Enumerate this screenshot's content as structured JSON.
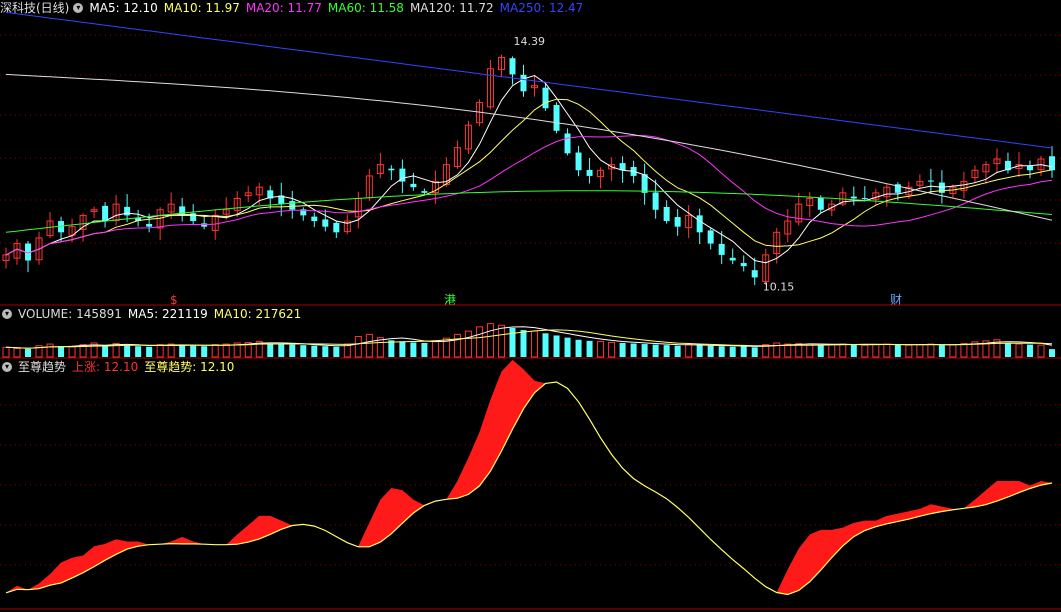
{
  "main": {
    "title": "深科技(日线)",
    "ma_legend": [
      {
        "label": "MA5: 12.10",
        "color": "#ffffff"
      },
      {
        "label": "MA10: 11.97",
        "color": "#ffff66"
      },
      {
        "label": "MA20: 11.77",
        "color": "#ff33ff"
      },
      {
        "label": "MA60: 11.58",
        "color": "#33ff33"
      },
      {
        "label": "MA120: 11.72",
        "color": "#dddddd"
      },
      {
        "label": "MA250: 12.47",
        "color": "#3344ff"
      }
    ],
    "high_label": "14.39",
    "low_label": "10.15",
    "markers": [
      {
        "text": "$",
        "color": "#ff3333"
      },
      {
        "text": "港",
        "color": "#33ff33"
      },
      {
        "text": "财",
        "color": "#66aaff"
      }
    ]
  },
  "volume": {
    "title": "VOLUME: 145891",
    "legend": [
      {
        "label": "MA5: 221119",
        "color": "#ffffff"
      },
      {
        "label": "MA10: 217621",
        "color": "#ffff66"
      }
    ]
  },
  "indicator": {
    "title": "至尊趋势",
    "legend": [
      {
        "label": "上涨: 12.10",
        "color": "#ff3333"
      },
      {
        "label": "至尊趋势: 12.10",
        "color": "#ffff66"
      }
    ]
  },
  "colors": {
    "up": "#ff3333",
    "down": "#54ffff",
    "background": "#000000",
    "grid": "#8b0000",
    "separator": "#aa0000"
  },
  "chart_data": {
    "type": "candlestick",
    "price_range": [
      9.8,
      14.8
    ],
    "high": 14.39,
    "low": 10.15,
    "ma5_last": 12.1,
    "ma10_last": 11.97,
    "ma20_last": 11.77,
    "ma60_last": 11.58,
    "ma120_last": 11.72,
    "ma250_last": 12.47,
    "volume_last": 145891,
    "volume_ma5_last": 221119,
    "volume_ma10_last": 217621,
    "trend_last": 12.1,
    "close_series": [
      10.6,
      10.8,
      10.5,
      10.9,
      11.2,
      11.0,
      11.1,
      11.3,
      11.4,
      11.2,
      11.5,
      11.3,
      11.2,
      11.1,
      11.4,
      11.5,
      11.3,
      11.2,
      11.1,
      11.3,
      11.4,
      11.6,
      11.7,
      11.8,
      11.6,
      11.5,
      11.4,
      11.3,
      11.2,
      11.1,
      11.0,
      11.2,
      11.6,
      12.0,
      12.2,
      12.1,
      11.9,
      11.8,
      11.7,
      11.9,
      12.2,
      12.5,
      12.9,
      13.3,
      13.9,
      14.1,
      13.8,
      13.5,
      13.6,
      13.2,
      12.8,
      12.4,
      12.1,
      12.0,
      12.1,
      12.2,
      12.1,
      12.0,
      11.7,
      11.4,
      11.2,
      11.1,
      11.3,
      11.0,
      10.8,
      10.6,
      10.5,
      10.4,
      10.2,
      10.6,
      11.0,
      11.2,
      11.5,
      11.6,
      11.4,
      11.5,
      11.7,
      11.6,
      11.6,
      11.7,
      11.8,
      11.7,
      11.8,
      11.9,
      11.9,
      11.7,
      11.8,
      11.9,
      12.1,
      12.2,
      12.3,
      12.1,
      12.2,
      12.1,
      12.3,
      12.1
    ],
    "volume_series": [
      180,
      160,
      150,
      210,
      240,
      200,
      190,
      230,
      260,
      220,
      250,
      210,
      200,
      190,
      230,
      240,
      220,
      210,
      200,
      230,
      240,
      260,
      270,
      290,
      250,
      240,
      230,
      220,
      210,
      200,
      190,
      240,
      380,
      420,
      360,
      310,
      290,
      270,
      260,
      300,
      350,
      420,
      480,
      560,
      620,
      590,
      540,
      500,
      480,
      440,
      400,
      360,
      320,
      300,
      290,
      270,
      260,
      250,
      240,
      230,
      220,
      210,
      230,
      220,
      210,
      200,
      190,
      200,
      180,
      230,
      260,
      240,
      250,
      240,
      220,
      230,
      240,
      230,
      220,
      230,
      240,
      230,
      220,
      230,
      240,
      220,
      230,
      250,
      280,
      300,
      320,
      260,
      240,
      230,
      220,
      146
    ]
  }
}
